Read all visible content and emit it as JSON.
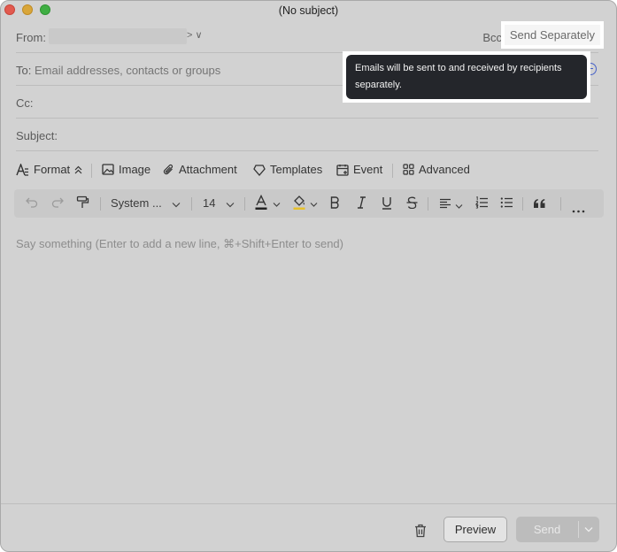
{
  "window": {
    "title": "(No subject)"
  },
  "from": {
    "label": "From:",
    "chevrons": "> ∨"
  },
  "header_actions": {
    "bcc": "Bcc",
    "send_separately": "Send Separately"
  },
  "tooltip": {
    "text": "Emails will be sent to and received by recipients separately."
  },
  "to": {
    "label": "To:",
    "placeholder": "Email addresses, contacts or groups"
  },
  "cc": {
    "label": "Cc:"
  },
  "subject": {
    "label": "Subject:"
  },
  "toolbar": {
    "format": "Format",
    "image": "Image",
    "attachment": "Attachment",
    "templates": "Templates",
    "event": "Event",
    "advanced": "Advanced"
  },
  "formatting": {
    "font_family": "System ...",
    "font_size": "14"
  },
  "editor": {
    "placeholder": "Say something (Enter to add a new line, ⌘+Shift+Enter to send)"
  },
  "footer": {
    "preview": "Preview",
    "send": "Send"
  },
  "colors": {
    "accent": "#4661c8",
    "tooltip_bg": "#24262b",
    "text_color_bar": "#222222",
    "highlight_bar": "#e6c02a"
  }
}
